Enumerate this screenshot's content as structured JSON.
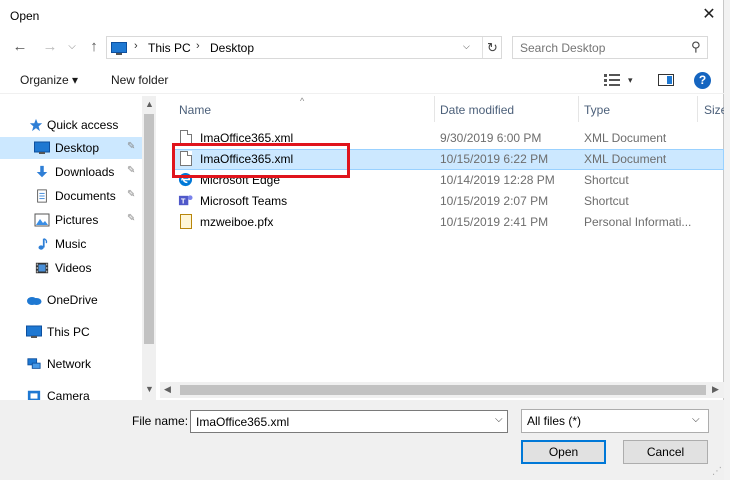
{
  "window": {
    "title": "Open",
    "close_glyph": "✕"
  },
  "nav": {
    "back": "←",
    "forward": "→",
    "dropdown": "⌵",
    "up": "↑",
    "breadcrumbs": [
      "This PC",
      "Desktop"
    ],
    "separator": "›",
    "address_dropdown": "⌵",
    "refresh": "↻"
  },
  "search": {
    "placeholder": "Search Desktop",
    "icon": "⚲"
  },
  "toolbar": {
    "organize_label": "Organize ▾",
    "new_folder_label": "New folder",
    "views_dropdown": "▾",
    "help_label": "?"
  },
  "sidebar": {
    "items": [
      {
        "label": "Quick access",
        "icon": "star-icon",
        "selected": false,
        "pinned": false
      },
      {
        "label": "Desktop",
        "icon": "desktop-icon",
        "selected": true,
        "pinned": true
      },
      {
        "label": "Downloads",
        "icon": "download-icon",
        "selected": false,
        "pinned": true
      },
      {
        "label": "Documents",
        "icon": "document-icon",
        "selected": false,
        "pinned": true
      },
      {
        "label": "Pictures",
        "icon": "pictures-icon",
        "selected": false,
        "pinned": true
      },
      {
        "label": "Music",
        "icon": "music-icon",
        "selected": false,
        "pinned": false
      },
      {
        "label": "Videos",
        "icon": "video-icon",
        "selected": false,
        "pinned": false
      },
      {
        "label": "OneDrive",
        "icon": "cloud-icon",
        "selected": false,
        "pinned": false
      },
      {
        "label": "This PC",
        "icon": "computer-icon",
        "selected": false,
        "pinned": false
      },
      {
        "label": "Network",
        "icon": "network-icon",
        "selected": false,
        "pinned": false
      },
      {
        "label": "Camera",
        "icon": "camera-icon",
        "selected": false,
        "pinned": false
      }
    ],
    "pin_glyph": "📌",
    "scroll_up": "▲",
    "scroll_down": "▼"
  },
  "filelist": {
    "columns": [
      "Name",
      "Date modified",
      "Type",
      "Size"
    ],
    "sort_indicator": "^",
    "rows": [
      {
        "name": "ImaOffice365.xml",
        "date": "9/30/2019 6:00 PM",
        "type": "XML Document",
        "icon": "xml-file-icon",
        "selected": false
      },
      {
        "name": "ImaOffice365.xml",
        "date": "10/15/2019 6:22 PM",
        "type": "XML Document",
        "icon": "xml-file-icon",
        "selected": true
      },
      {
        "name": "Microsoft Edge",
        "date": "10/14/2019 12:28 PM",
        "type": "Shortcut",
        "icon": "edge-icon",
        "selected": false
      },
      {
        "name": "Microsoft Teams",
        "date": "10/15/2019 2:07 PM",
        "type": "Shortcut",
        "icon": "teams-icon",
        "selected": false
      },
      {
        "name": "mzweiboe.pfx",
        "date": "10/15/2019 2:41 PM",
        "type": "Personal Informati...",
        "icon": "certificate-icon",
        "selected": false
      }
    ],
    "scroll_left": "◀",
    "scroll_right": "▶"
  },
  "footer": {
    "file_name_label": "File name:",
    "file_name_value": "ImaOffice365.xml",
    "file_name_dropdown": "⌵",
    "file_type_value": "All files (*)",
    "file_type_dropdown": "⌵",
    "open_label": "Open",
    "cancel_label": "Cancel"
  },
  "colors": {
    "selection": "#cce8ff",
    "highlight_box": "#e0141c",
    "accent": "#0078d7"
  }
}
